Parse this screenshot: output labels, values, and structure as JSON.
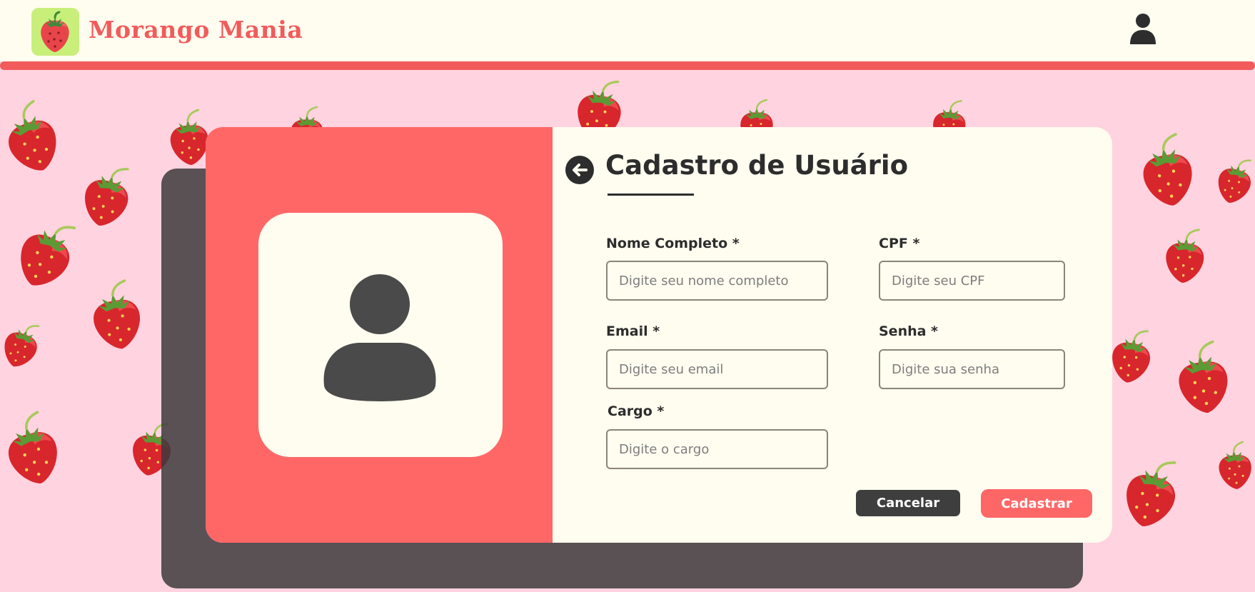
{
  "header": {
    "brand": "Morango Mania",
    "logo_icon": "strawberry-icon",
    "user_icon": "user-icon"
  },
  "colors": {
    "accent": "#f25b5b",
    "panel": "#ff6767",
    "cream": "#fffdf0",
    "background": "#ffd3df",
    "dark": "#2d2d2d",
    "logo_bg": "#c8ef7a"
  },
  "form": {
    "title": "Cadastro de Usuário",
    "back_icon": "arrow-left-icon",
    "avatar_icon": "user-avatar-icon",
    "fields": {
      "nome": {
        "label": "Nome Completo *",
        "placeholder": "Digite seu nome completo",
        "value": ""
      },
      "cpf": {
        "label": "CPF *",
        "placeholder": "Digite seu CPF",
        "value": ""
      },
      "email": {
        "label": "Email *",
        "placeholder": "Digite seu email",
        "value": ""
      },
      "senha": {
        "label": "Senha *",
        "placeholder": "Digite sua senha",
        "value": ""
      },
      "cargo": {
        "label": "Cargo *",
        "placeholder": "Digite o cargo",
        "value": ""
      }
    },
    "buttons": {
      "cancel": "Cancelar",
      "submit": "Cadastrar"
    }
  }
}
